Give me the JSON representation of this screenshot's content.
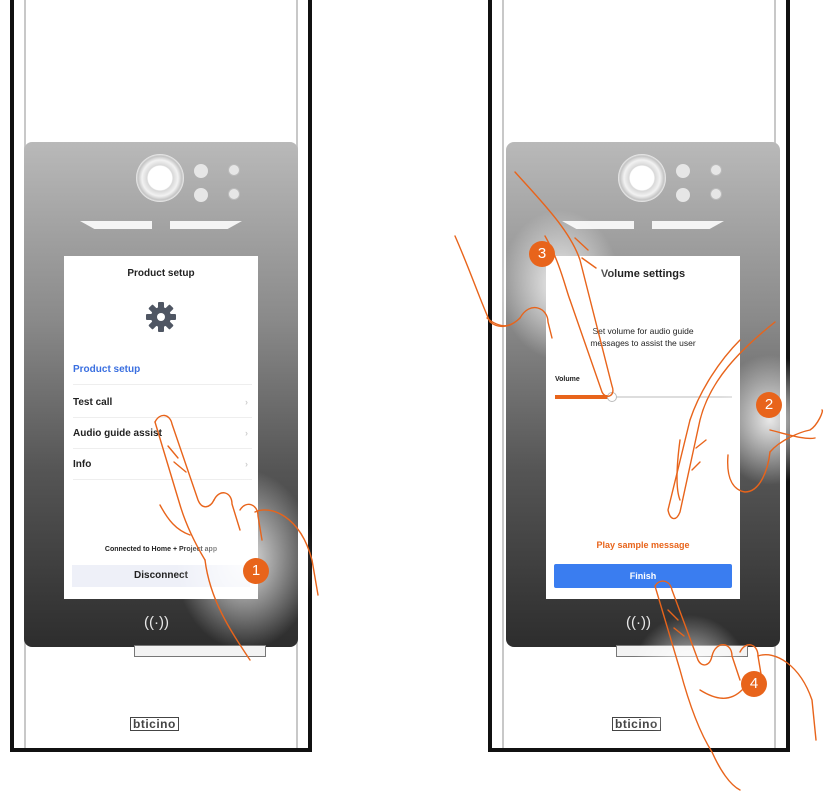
{
  "left_device": {
    "screen": {
      "title": "Product setup",
      "icon": "gear-icon",
      "menu": [
        {
          "label": "Product setup",
          "active": true
        },
        {
          "label": "Test call",
          "active": false
        },
        {
          "label": "Audio guide assist",
          "active": false
        },
        {
          "label": "Info",
          "active": false
        }
      ],
      "status": "Connected to Home + Project app",
      "disconnect_label": "Disconnect"
    },
    "nfc_symbol": "((·))",
    "brand": "bticino",
    "step_badge": "1"
  },
  "right_device": {
    "screen": {
      "title": "Volume settings",
      "description_line1": "Set volume for audio guide",
      "description_line2": "messages to assist the user",
      "volume_label": "Volume",
      "volume_level": 0.32,
      "sample_label": "Play sample message",
      "finish_label": "Finish"
    },
    "nfc_symbol": "((·))",
    "brand": "bticino",
    "step_badges": [
      "3",
      "2",
      "4"
    ]
  },
  "colors": {
    "accent": "#e8641b",
    "primary_blue": "#3a7df0",
    "active_text_blue": "#3a6fe0",
    "frame": "#111111"
  }
}
